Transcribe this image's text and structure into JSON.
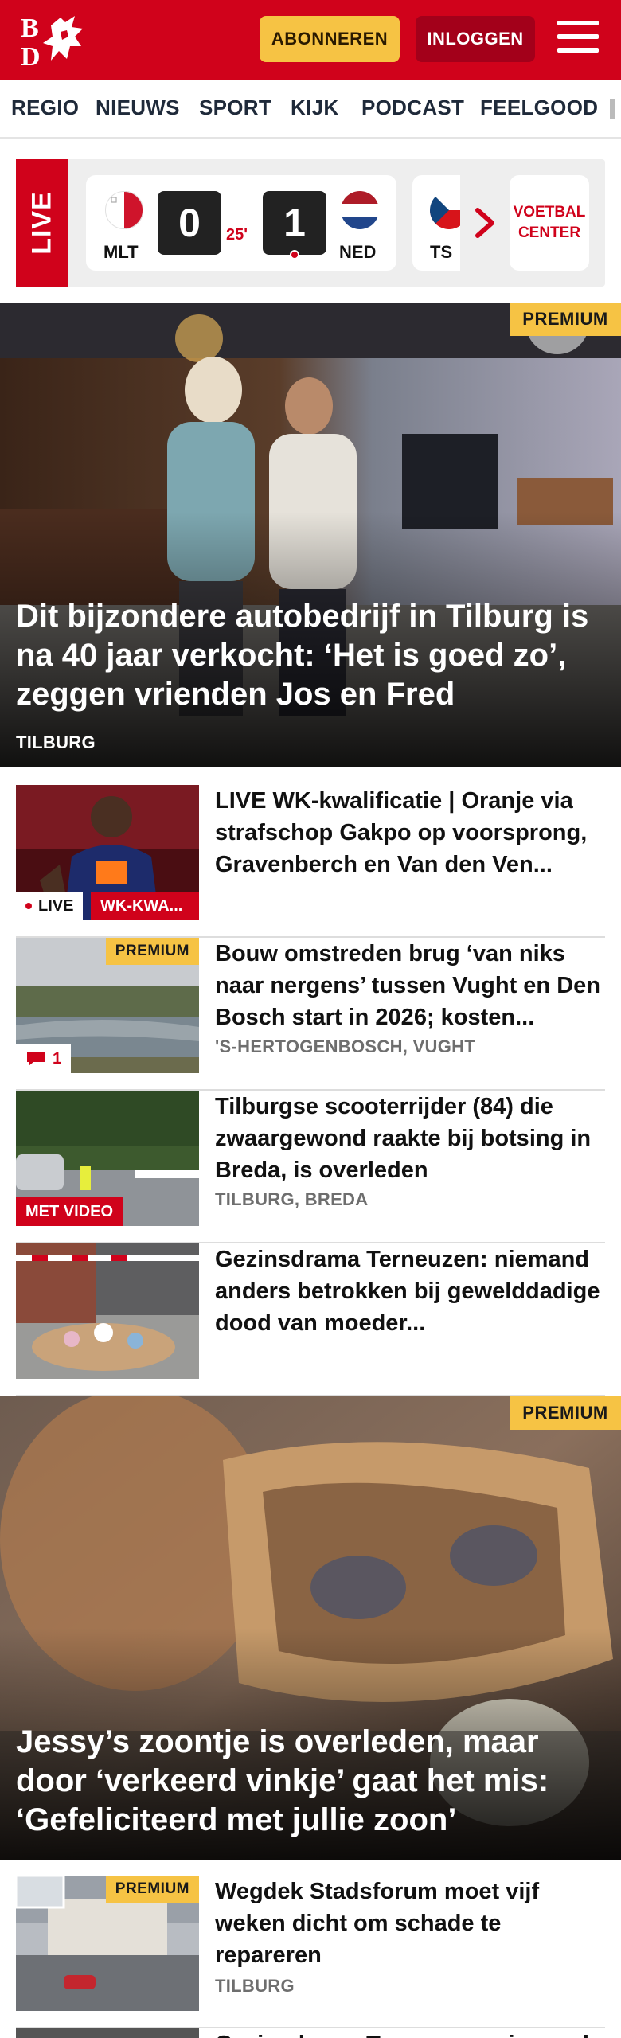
{
  "header": {
    "logo_text": "BD",
    "subscribe_label": "ABONNEREN",
    "login_label": "INLOGGEN",
    "brand_color": "#d0021b"
  },
  "nav": {
    "items": [
      "REGIO",
      "NIEUWS",
      "SPORT",
      "KIJK",
      "PODCAST",
      "FEELGOOD"
    ]
  },
  "live_widget": {
    "live_label": "LIVE",
    "match": {
      "home_code": "MLT",
      "home_score": "0",
      "minute": "25'",
      "away_score": "1",
      "away_code": "NED"
    },
    "next_match_code": "TS",
    "voetbal_line1": "VOETBAL",
    "voetbal_line2": "CENTER"
  },
  "hero1": {
    "premium_label": "PREMIUM",
    "title": "Dit bijzondere autobedrijf in Tilburg is na 40 jaar verkocht: ‘Het is goed zo’, zeggen vrienden Jos en Fred",
    "location": "TILBURG"
  },
  "articles": [
    {
      "title": "LIVE WK-kwalificatie | Oranje via strafschop Gakpo op voorsprong, Gravenberch en Van den Ven...",
      "live_label": "LIVE",
      "tag_label": "WK-KWA..."
    },
    {
      "title": "Bouw omstreden brug ‘van niks naar nergens’ tussen Vught en Den Bosch start in 2026; kosten...",
      "location": "'S-HERTOGENBOSCH, VUGHT",
      "premium_label": "PREMIUM",
      "comment_count": "1"
    },
    {
      "title": "Tilburgse scooterrijder (84) die zwaargewond raakte bij botsing in Breda, is overleden",
      "location": "TILBURG, BREDA",
      "video_label": "MET VIDEO"
    },
    {
      "title": "Gezinsdrama Terneuzen: niemand anders betrokken bij gewelddadige dood van moeder..."
    }
  ],
  "hero2": {
    "premium_label": "PREMIUM",
    "title": "Jessy’s zoontje is overleden, maar door ‘verkeerd vinkje’ gaat het mis: ‘Gefeliciteerd met jullie zoon’"
  },
  "article_bottom": {
    "title": "Wegdek Stadsforum moet vijf weken dicht om schade te repareren",
    "location": "TILBURG",
    "premium_label": "PREMIUM"
  },
  "article_cut": {
    "title": "Gezinsdrama Terneuzen: niemand anders betrokken"
  }
}
